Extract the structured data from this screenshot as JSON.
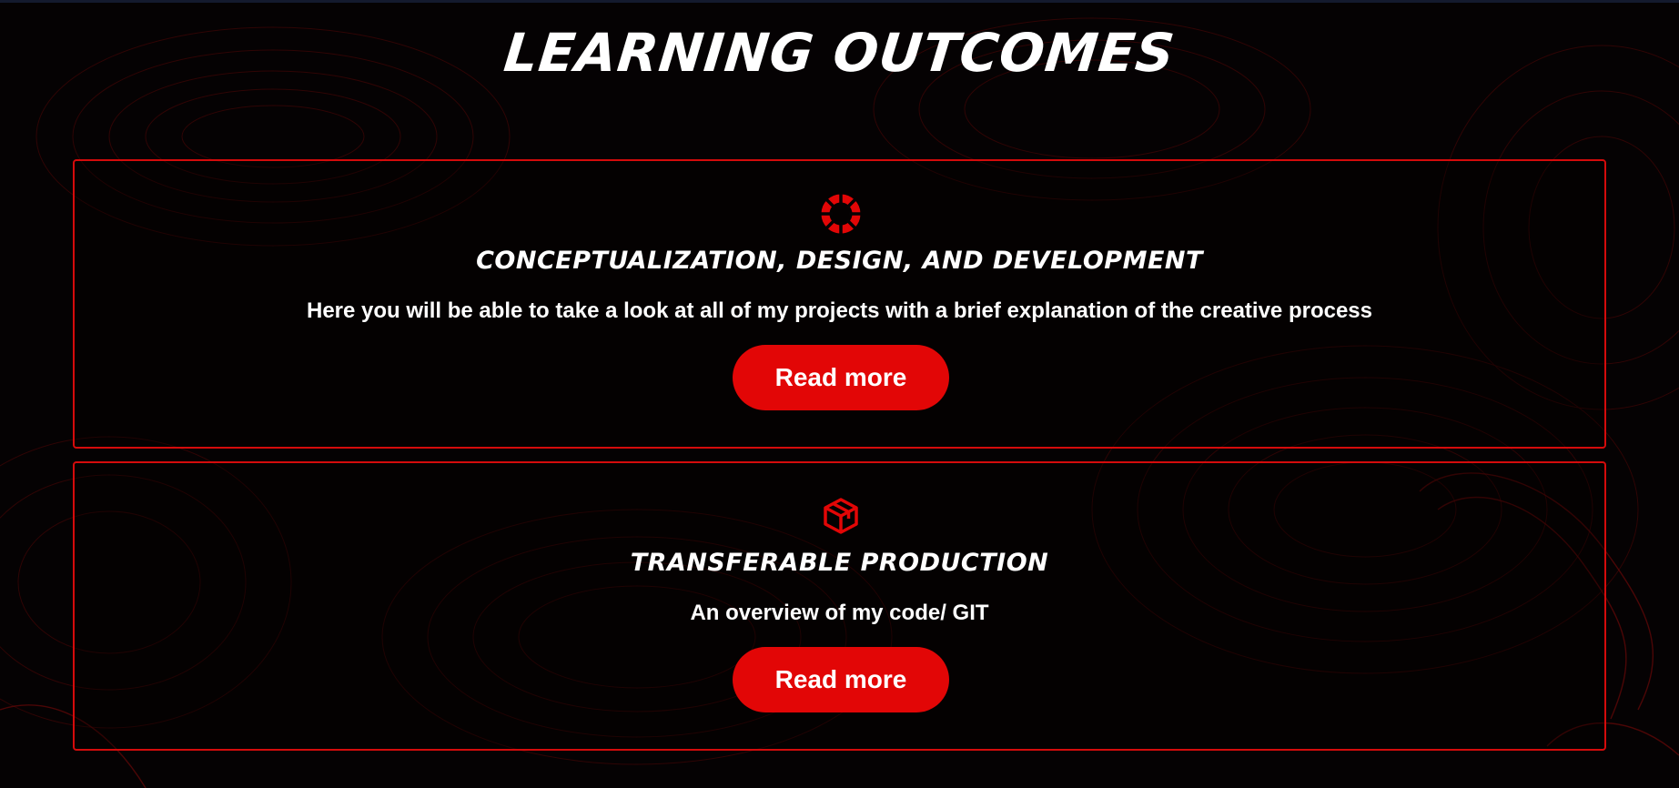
{
  "page": {
    "title": "LEARNING OUTCOMES"
  },
  "cards": [
    {
      "icon": "lifebuoy-icon",
      "title": "CONCEPTUALIZATION, DESIGN, AND DEVELOPMENT",
      "description": "Here you will be able to take a look at all of my projects with a brief explanation of the creative process",
      "button_label": "Read more"
    },
    {
      "icon": "package-icon",
      "title": "TRANSFERABLE PRODUCTION",
      "description": "An overview of my code/ GIT",
      "button_label": "Read more"
    }
  ],
  "colors": {
    "accent": "#e20606",
    "background": "#050203",
    "text": "#ffffff"
  }
}
